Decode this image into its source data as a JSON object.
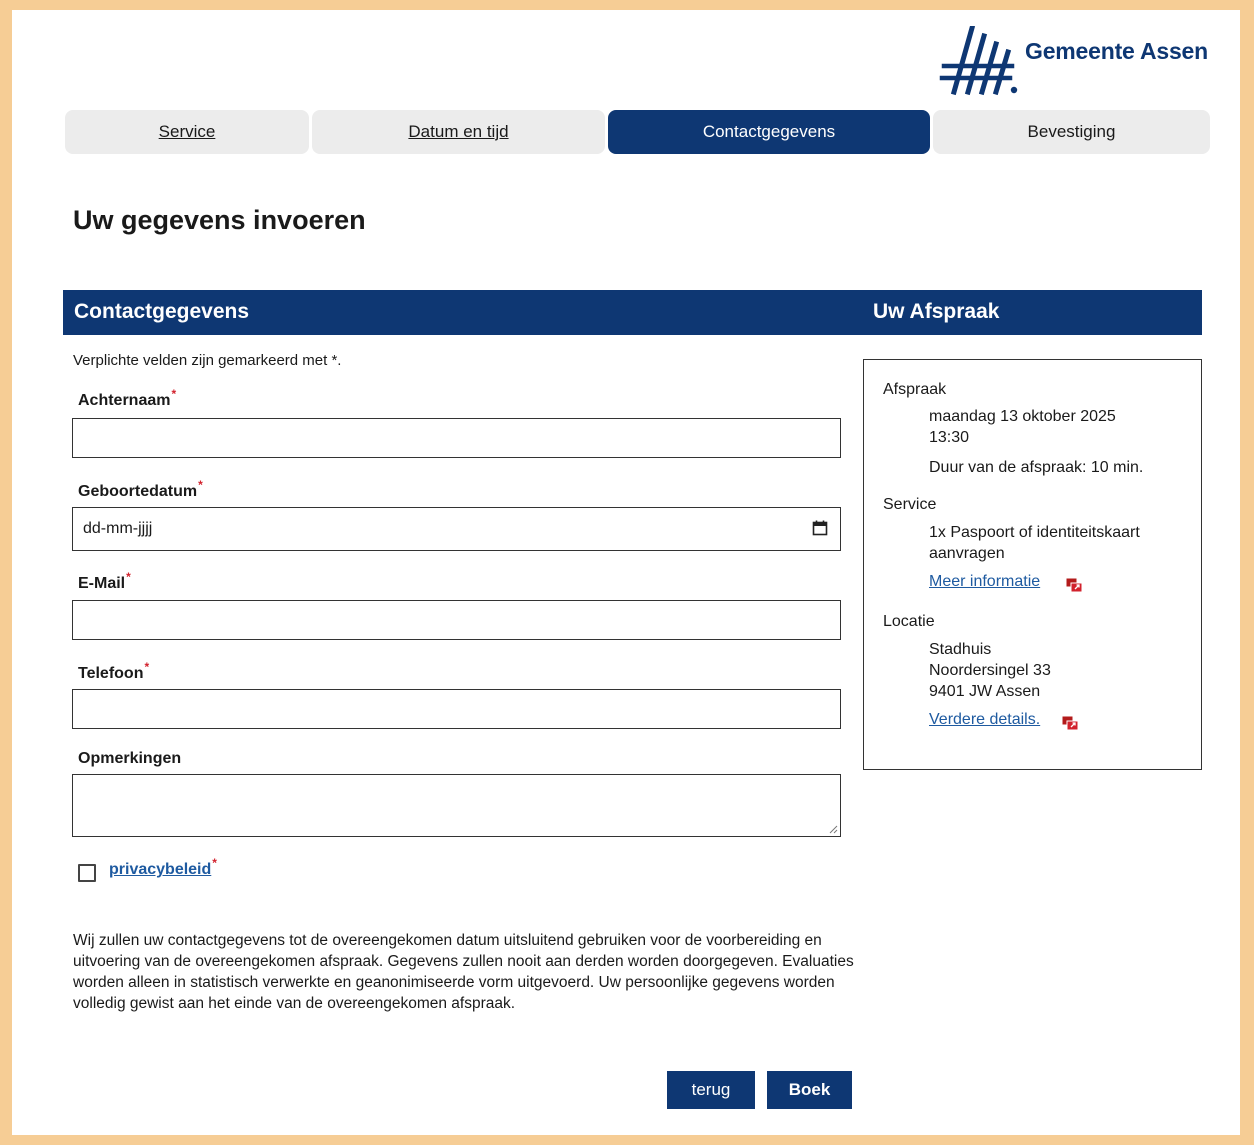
{
  "brand": {
    "name": "Gemeente Assen",
    "logo_color": "#0e3773"
  },
  "steps": [
    {
      "label": "Service",
      "state": "link"
    },
    {
      "label": "Datum en tijd",
      "state": "link"
    },
    {
      "label": "Contactgegevens",
      "state": "active"
    },
    {
      "label": "Bevestiging",
      "state": "inactive"
    }
  ],
  "page_title": "Uw gegevens invoeren",
  "form": {
    "section_title": "Contactgegevens",
    "required_note": "Verplichte velden zijn gemarkeerd met *.",
    "required_marker": "*",
    "fields": {
      "lastname": {
        "label": "Achternaam",
        "value": ""
      },
      "birthdate": {
        "label": "Geboortedatum",
        "placeholder": "dd-mm-jjjj"
      },
      "email": {
        "label": "E-Mail",
        "value": ""
      },
      "phone": {
        "label": "Telefoon",
        "value": ""
      },
      "remarks": {
        "label": "Opmerkingen",
        "value": ""
      }
    },
    "privacy_label": "privacybeleid",
    "privacy_checked": false,
    "privacy_text": "Wij zullen uw contactgegevens tot de overeengekomen datum uitsluitend gebruiken voor de voorbereiding en uitvoering van de overeengekomen afspraak. Gegevens zullen nooit aan derden worden doorgegeven. Evaluaties worden alleen in statistisch verwerkte en geanonimiseerde vorm uitgevoerd. Uw persoonlijke gegevens worden volledig gewist aan het einde van de overeengekomen afspraak.",
    "back_button": "terug",
    "book_button": "Boek"
  },
  "appointment": {
    "section_title": "Uw Afspraak",
    "afspraak_label": "Afspraak",
    "date": "maandag 13 oktober 2025",
    "time": "13:30",
    "duration": "Duur van de afspraak: 10 min.",
    "service_label": "Service",
    "service_line1": "1x Paspoort of identiteitskaart",
    "service_line2": "aanvragen",
    "more_info": "Meer informatie",
    "location_label": "Locatie",
    "location_name": "Stadhuis",
    "location_street": "Noordersingel 33",
    "location_city": "9401 JW Assen",
    "more_details": "Verdere details.",
    "external_link_icon": "external-link-icon"
  },
  "colors": {
    "primary": "#0e3773",
    "required": "#d2222d",
    "link": "#1e5aa0",
    "frame": "#f6cd95"
  }
}
